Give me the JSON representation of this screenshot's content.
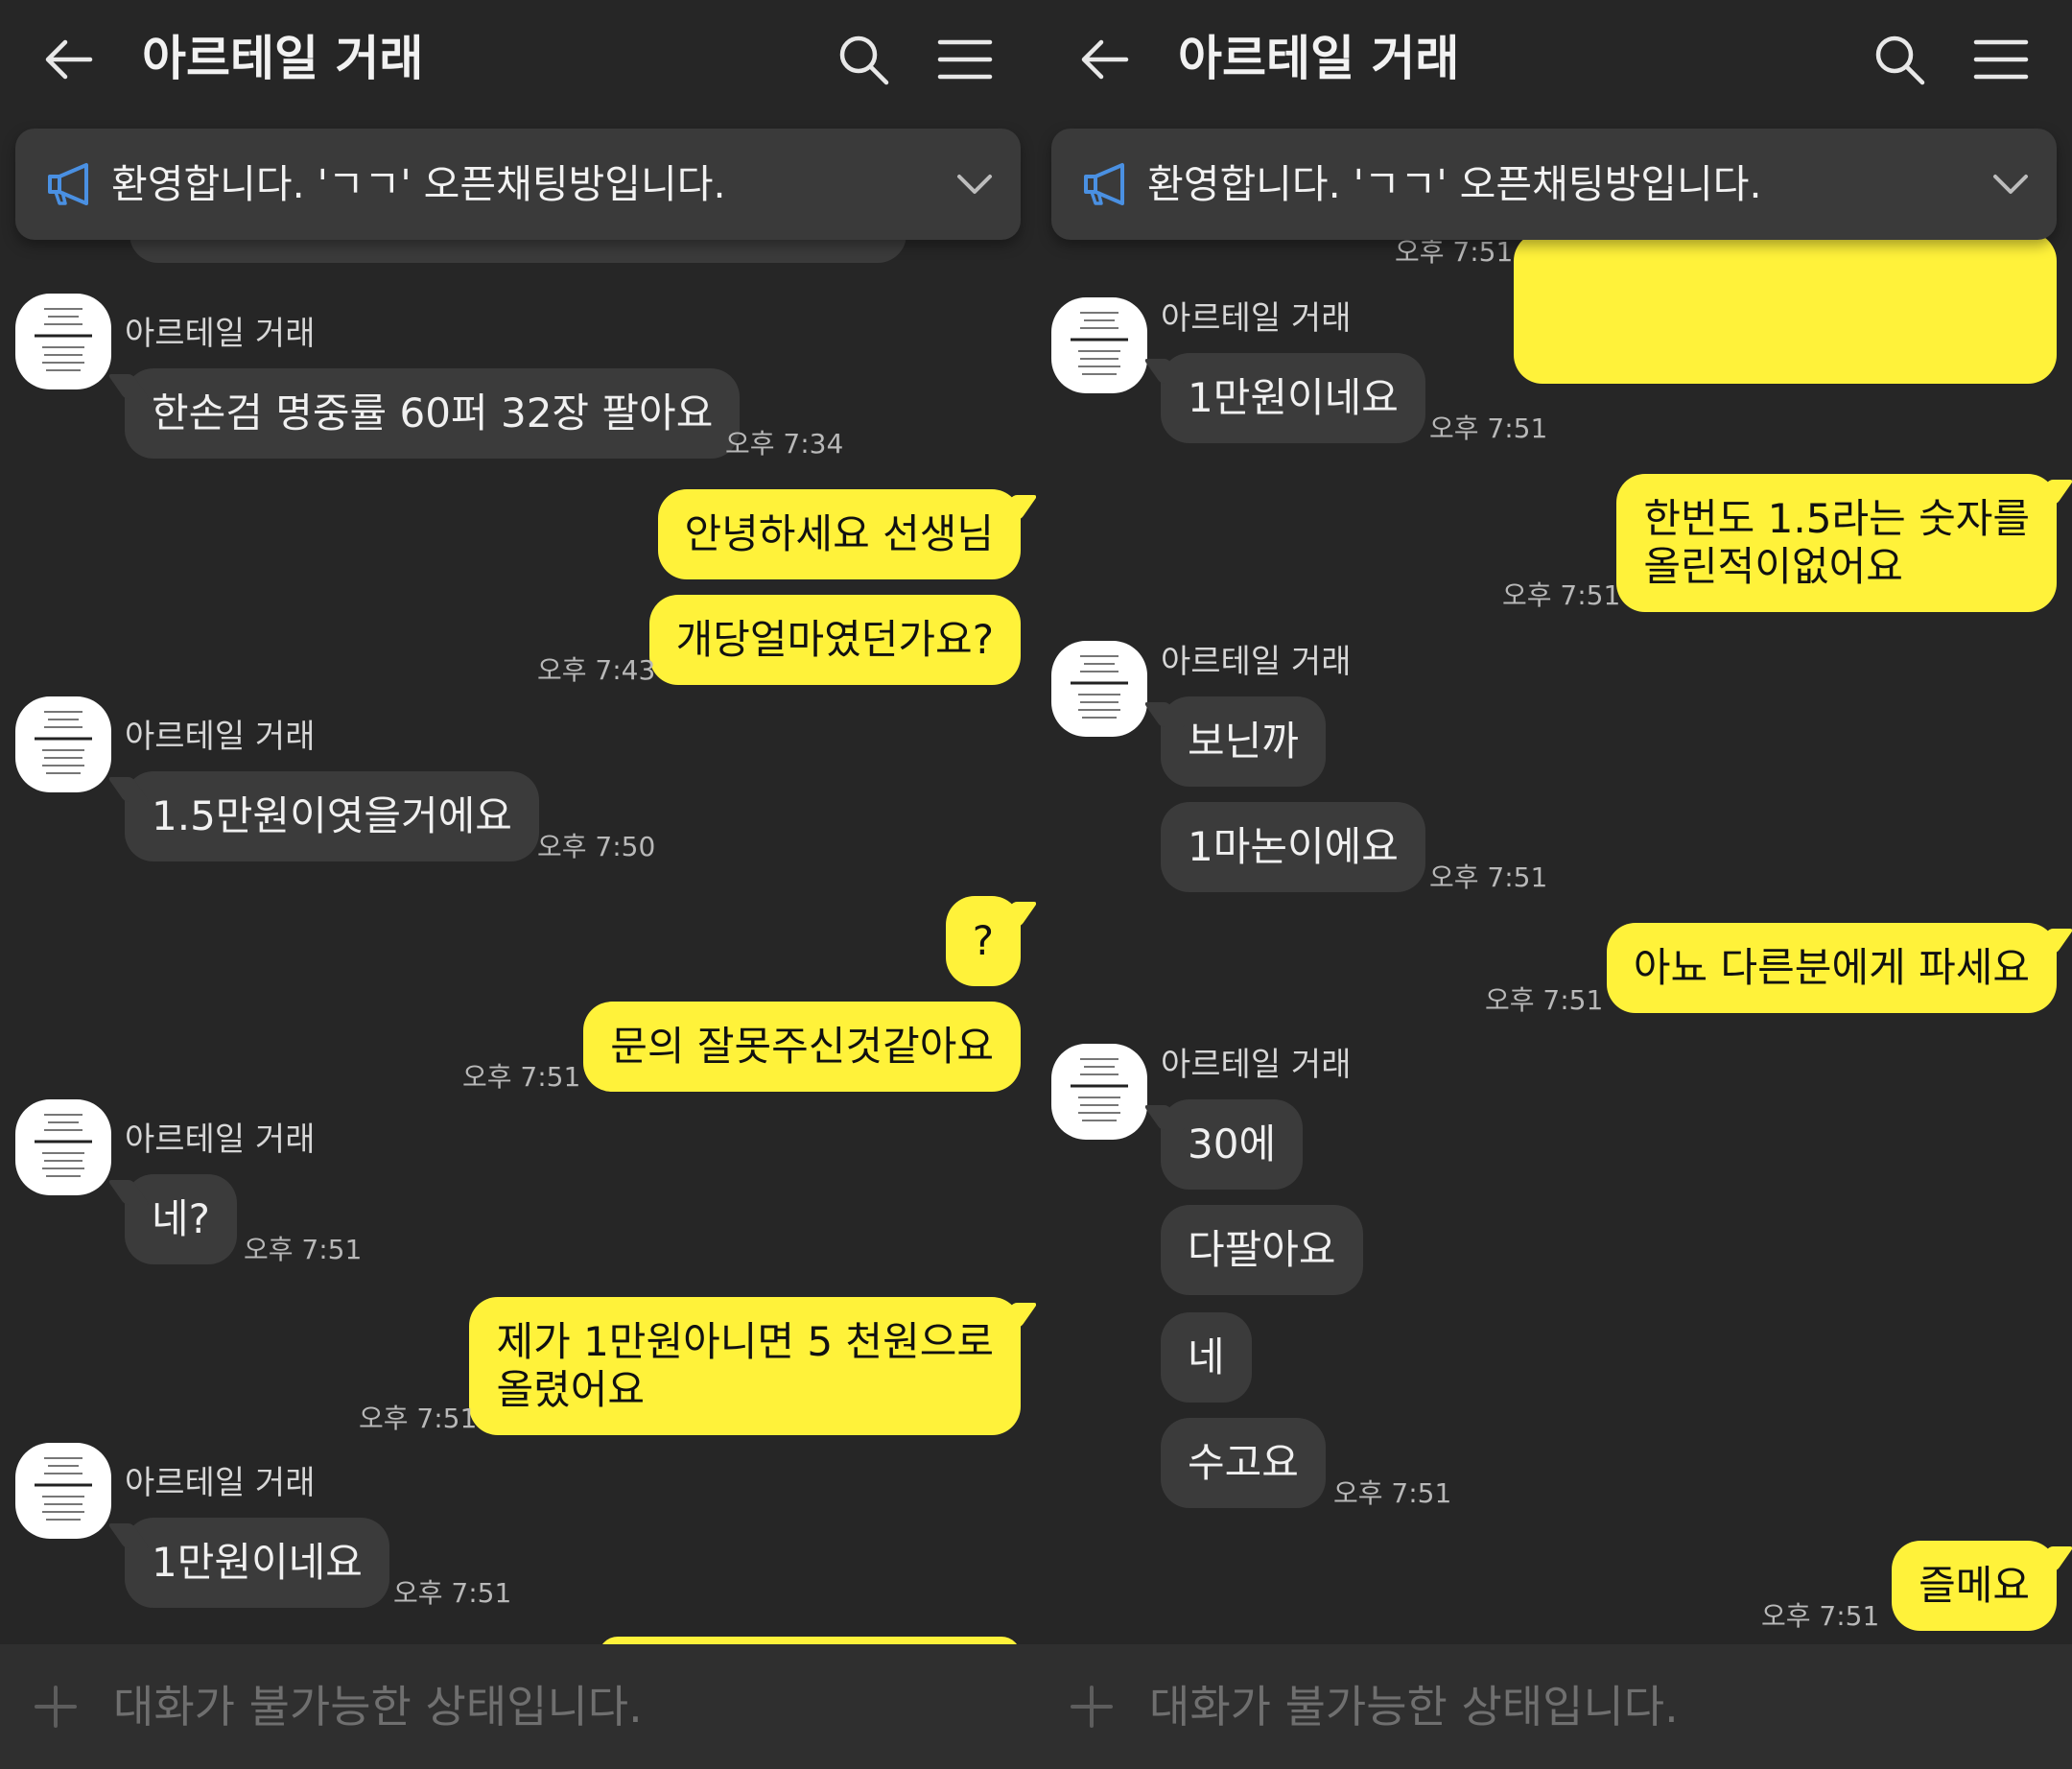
{
  "panels": [
    {
      "header_title": "아르테일 거래",
      "notice_text": "환영합니다. 'ㄱㄱ' 오픈채팅방입니다.",
      "input_placeholder": "대화가 불가능한 상태입니다.",
      "messages": [
        {
          "sender": "아르테일 거래",
          "text": "한손검 명중률 60퍼 32장 팔아요",
          "time": "오후 7:34"
        },
        {
          "text": "안녕하세요 선생님"
        },
        {
          "text": "개당얼마였던가요?",
          "time": "오후 7:43"
        },
        {
          "sender": "아르테일 거래",
          "text": "1.5만원이엿을거에요",
          "time": "오후 7:50"
        },
        {
          "text": "?"
        },
        {
          "text": "문의 잘못주신것같아요",
          "time": "오후 7:51"
        },
        {
          "sender": "아르테일 거래",
          "text": "네?",
          "time": "오후 7:51"
        },
        {
          "text": [
            "제가 1만원아니면 5 천원으로",
            "올렸어요"
          ],
          "time": "오후 7:51"
        },
        {
          "sender": "아르테일 거래",
          "text": "1만원이네요",
          "time": "오후 7:51"
        }
      ]
    },
    {
      "header_title": "아르테일 거래",
      "notice_text": "환영합니다. 'ㄱㄱ' 오픈채팅방입니다.",
      "input_placeholder": "대화가 불가능한 상태입니다.",
      "messages": [
        {
          "time": "오후 7:51"
        },
        {
          "sender": "아르테일 거래",
          "text": "1만원이네요",
          "time": "오후 7:51"
        },
        {
          "text": [
            "한번도 1.5라는 숫자를",
            "올린적이없어요"
          ],
          "time": "오후 7:51"
        },
        {
          "sender": "아르테일 거래",
          "text": "보닌까"
        },
        {
          "text": "1마논이에요",
          "time": "오후 7:51"
        },
        {
          "text": "아뇨 다른분에게 파세요",
          "time": "오후 7:51"
        },
        {
          "sender": "아르테일 거래",
          "text": "30에"
        },
        {
          "text": "다팔아요"
        },
        {
          "text": "네"
        },
        {
          "text": "수고요",
          "time": "오후 7:51"
        },
        {
          "text": "즐메요",
          "time": "오후 7:51"
        }
      ]
    }
  ]
}
